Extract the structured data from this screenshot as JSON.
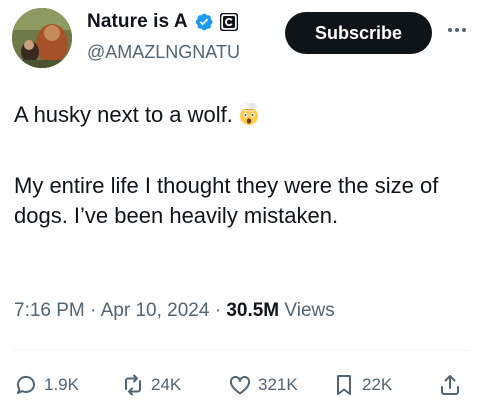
{
  "author": {
    "name": "Nature is A",
    "handle": "@AMAZLNGNATU",
    "avatar_icon": "orangutan-with-cub-avatar",
    "verified_icon": "verified-badge-icon",
    "affiliate_icon": "affiliate-badge-icon"
  },
  "subscribe_label": "Subscribe",
  "more_icon": "more-options-icon",
  "post": {
    "line1": "A husky next to a wolf.",
    "line1_emoji": "exploding-head-emoji",
    "paragraph2": "My entire life I thought they were the size of dogs. I’ve been heavily mistaken."
  },
  "meta": {
    "time": "7:16 PM",
    "separator": "·",
    "date": "Apr 10, 2024",
    "views_count": "30.5M",
    "views_label": "Views"
  },
  "actions": {
    "replies": "1.9K",
    "reposts": "24K",
    "likes": "321K",
    "bookmarks": "22K"
  },
  "colors": {
    "text": "#0f1419",
    "secondary": "#536471",
    "verified": "#1d9bf0",
    "subscribe_bg": "#0f1419"
  }
}
